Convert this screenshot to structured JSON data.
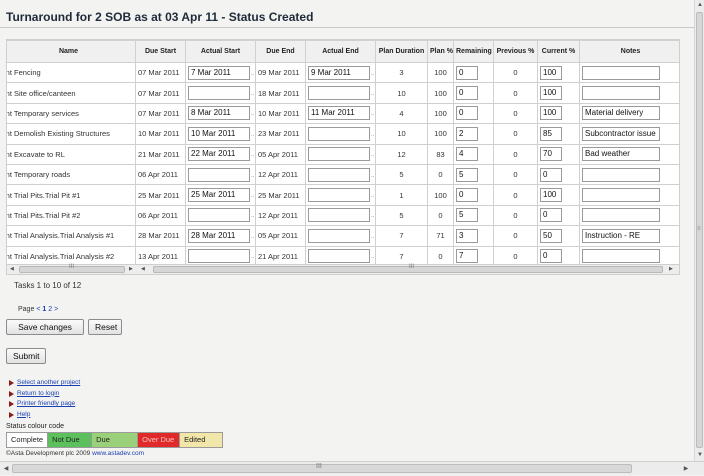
{
  "page_title": "Turnaround for 2 SOB as at 03 Apr 11 - Status Created",
  "columns": [
    "Name",
    "Due Start",
    "Actual Start",
    "Due End",
    "Actual End",
    "Plan Duration",
    "Plan %",
    "Remaining",
    "Previous %",
    "Current %",
    "Notes"
  ],
  "rows": [
    {
      "prefix": "int",
      "name": "Fencing",
      "due_start": "07 Mar 2011",
      "actual_start": "7 Mar 2011",
      "due_end": "09 Mar 2011",
      "actual_end": "9 Mar 2011",
      "plan_duration": "3",
      "plan_pct": "100",
      "remaining": "0",
      "previous_pct": "0",
      "current_pct": "100",
      "notes": ""
    },
    {
      "prefix": "int",
      "name": "Site office/canteen",
      "due_start": "07 Mar 2011",
      "actual_start": "",
      "due_end": "18 Mar 2011",
      "actual_end": "",
      "plan_duration": "10",
      "plan_pct": "100",
      "remaining": "0",
      "previous_pct": "0",
      "current_pct": "100",
      "notes": ""
    },
    {
      "prefix": "int",
      "name": "Temporary services",
      "due_start": "07 Mar 2011",
      "actual_start": "8 Mar 2011",
      "due_end": "10 Mar 2011",
      "actual_end": "11 Mar 2011",
      "plan_duration": "4",
      "plan_pct": "100",
      "remaining": "0",
      "previous_pct": "0",
      "current_pct": "100",
      "notes": "Material delivery"
    },
    {
      "prefix": "int",
      "name": "Demolish Existing Structures",
      "due_start": "10 Mar 2011",
      "actual_start": "10 Mar 2011",
      "due_end": "23 Mar 2011",
      "actual_end": "",
      "plan_duration": "10",
      "plan_pct": "100",
      "remaining": "2",
      "previous_pct": "0",
      "current_pct": "85",
      "notes": "Subcontractor issue"
    },
    {
      "prefix": "int",
      "name": "Excavate to RL",
      "due_start": "21 Mar 2011",
      "actual_start": "22 Mar 2011",
      "due_end": "05 Apr 2011",
      "actual_end": "",
      "plan_duration": "12",
      "plan_pct": "83",
      "remaining": "4",
      "previous_pct": "0",
      "current_pct": "70",
      "notes": "Bad weather"
    },
    {
      "prefix": "int",
      "name": "Temporary roads",
      "due_start": "06 Apr 2011",
      "actual_start": "",
      "due_end": "12 Apr 2011",
      "actual_end": "",
      "plan_duration": "5",
      "plan_pct": "0",
      "remaining": "5",
      "previous_pct": "0",
      "current_pct": "0",
      "notes": ""
    },
    {
      "prefix": "int",
      "name": "Trial Pits.Trial Pit #1",
      "due_start": "25 Mar 2011",
      "actual_start": "25 Mar 2011",
      "due_end": "25 Mar 2011",
      "actual_end": "",
      "plan_duration": "1",
      "plan_pct": "100",
      "remaining": "0",
      "previous_pct": "0",
      "current_pct": "100",
      "notes": ""
    },
    {
      "prefix": "int",
      "name": "Trial Pits.Trial Pit #2",
      "due_start": "06 Apr 2011",
      "actual_start": "",
      "due_end": "12 Apr 2011",
      "actual_end": "",
      "plan_duration": "5",
      "plan_pct": "0",
      "remaining": "5",
      "previous_pct": "0",
      "current_pct": "0",
      "notes": ""
    },
    {
      "prefix": "int",
      "name": "Trial Analysis.Trial Analysis #1",
      "due_start": "28 Mar 2011",
      "actual_start": "28 Mar 2011",
      "due_end": "05 Apr 2011",
      "actual_end": "",
      "plan_duration": "7",
      "plan_pct": "71",
      "remaining": "3",
      "previous_pct": "0",
      "current_pct": "50",
      "notes": "Instruction - RE"
    },
    {
      "prefix": "int",
      "name": "Trial Analysis.Trial Analysis #2",
      "due_start": "13 Apr 2011",
      "actual_start": "",
      "due_end": "21 Apr 2011",
      "actual_end": "",
      "plan_duration": "7",
      "plan_pct": "0",
      "remaining": "7",
      "previous_pct": "0",
      "current_pct": "0",
      "notes": ""
    }
  ],
  "tasks_text": "Tasks 1 to 10 of 12",
  "pager": {
    "label": "Page",
    "prev": "<",
    "pages": [
      "1",
      "2"
    ],
    "next": ">"
  },
  "buttons": {
    "save": "Save changes",
    "reset": "Reset",
    "submit": "Submit"
  },
  "links": [
    "Select another project",
    "Return to login",
    "Printer friendly page",
    "Help"
  ],
  "legend": {
    "title": "Status colour code",
    "items": [
      {
        "label": "Complete",
        "color": "#ffffff"
      },
      {
        "label": "Not Due",
        "color": "#5cc05c"
      },
      {
        "label": "Due",
        "color": "#9bd07a"
      },
      {
        "label": "Over Due",
        "color": "#e02a2a"
      },
      {
        "label": "Edited",
        "color": "#f2e6a8"
      }
    ]
  },
  "footer": {
    "copyright": "©Asta Development plc 2009 ",
    "url": "www.astadev.com"
  },
  "colors": {
    "current_cell": "#9bd07a",
    "link": "#1a3fb0"
  }
}
